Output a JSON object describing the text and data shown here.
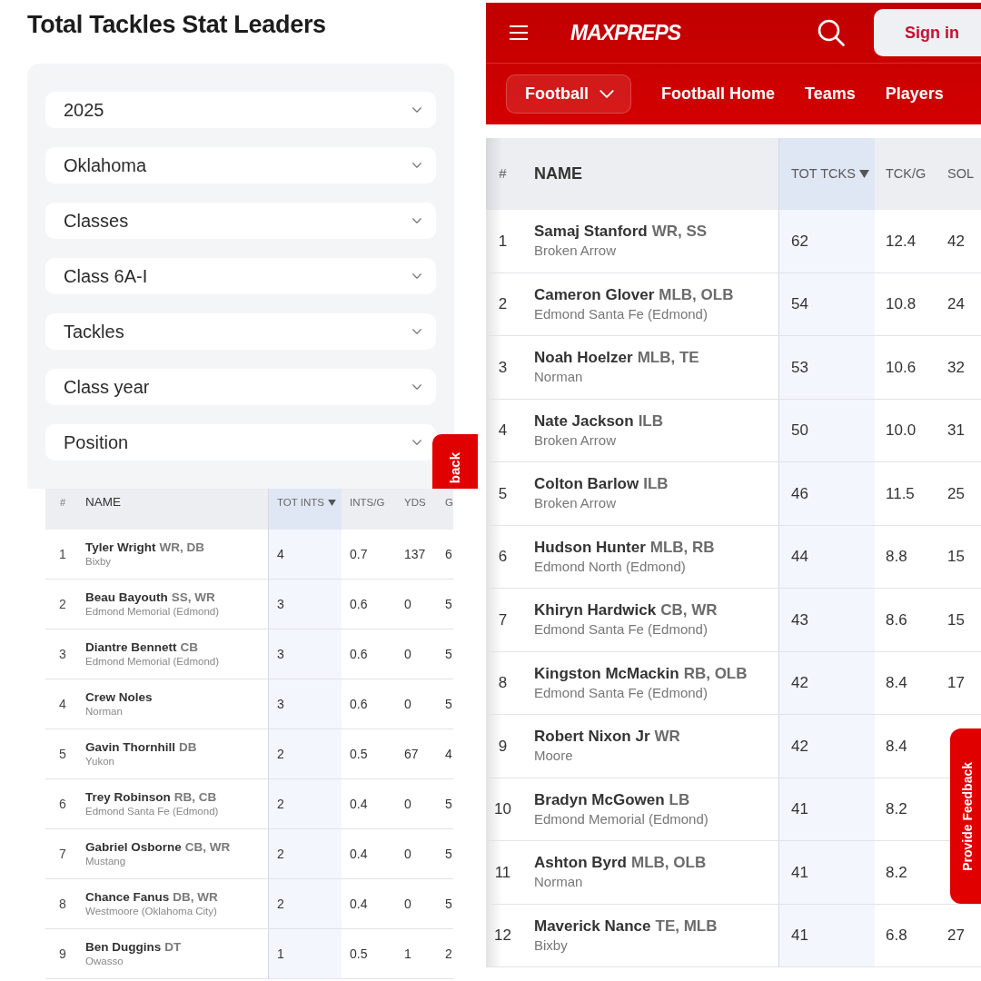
{
  "left_panel": {
    "title": "Total Tackles Stat Leaders",
    "filters": [
      {
        "value": "2025"
      },
      {
        "value": "Oklahoma"
      },
      {
        "value": "Classes"
      },
      {
        "value": "Class 6A-I"
      },
      {
        "value": "Tackles"
      },
      {
        "value": "Class year"
      },
      {
        "value": "Position"
      }
    ],
    "feedback_tab": {
      "label": "back"
    }
  },
  "left_table": {
    "columns": [
      {
        "label": "#",
        "sorted": false
      },
      {
        "label": "NAME",
        "sorted": false
      },
      {
        "label": "TOT INTS",
        "sorted": true
      },
      {
        "label": "INTS/G",
        "sorted": false
      },
      {
        "label": "YDS",
        "sorted": false
      },
      {
        "label": "G",
        "sorted": false
      }
    ],
    "rows": [
      {
        "rank": "1",
        "name": "Tyler Wright",
        "positions": "WR, DB",
        "school": "Bixby",
        "stats": [
          "4",
          "0.7",
          "137",
          "6"
        ]
      },
      {
        "rank": "2",
        "name": "Beau Bayouth",
        "positions": "SS, WR",
        "school": "Edmond Memorial (Edmond)",
        "stats": [
          "3",
          "0.6",
          "0",
          "5"
        ]
      },
      {
        "rank": "3",
        "name": "Diantre Bennett",
        "positions": "CB",
        "school": "Edmond Memorial (Edmond)",
        "stats": [
          "3",
          "0.6",
          "0",
          "5"
        ]
      },
      {
        "rank": "4",
        "name": "Crew Noles",
        "school": "Norman",
        "stats": [
          "3",
          "0.6",
          "0",
          "5"
        ]
      },
      {
        "rank": "5",
        "name": "Gavin Thornhill",
        "positions": "DB",
        "school": "Yukon",
        "stats": [
          "2",
          "0.5",
          "67",
          "4"
        ]
      },
      {
        "rank": "6",
        "name": "Trey Robinson",
        "positions": "RB, CB",
        "school": "Edmond Santa Fe (Edmond)",
        "stats": [
          "2",
          "0.4",
          "0",
          "5"
        ]
      },
      {
        "rank": "7",
        "name": "Gabriel Osborne",
        "positions": "CB, WR",
        "school": "Mustang",
        "stats": [
          "2",
          "0.4",
          "0",
          "5"
        ]
      },
      {
        "rank": "8",
        "name": "Chance Fanus",
        "positions": "DB, WR",
        "school": "Westmoore (Oklahoma City)",
        "stats": [
          "2",
          "0.4",
          "0",
          "5"
        ]
      },
      {
        "rank": "9",
        "name": "Ben Duggins",
        "positions": "DT",
        "school": "Owasso",
        "stats": [
          "1",
          "0.5",
          "1",
          "2"
        ]
      }
    ]
  },
  "right_panel": {
    "logo": "MAXPREPS",
    "sign_in": "Sign in",
    "nav": [
      {
        "label": "Football",
        "kind": "dropdown"
      },
      {
        "label": "Football Home",
        "kind": "link"
      },
      {
        "label": "Teams",
        "kind": "link"
      },
      {
        "label": "Players",
        "kind": "link"
      }
    ],
    "table": {
      "columns": [
        {
          "label": "#",
          "sorted": false
        },
        {
          "label": "NAME",
          "sorted": false
        },
        {
          "label": "TOT TCKS",
          "sorted": true
        },
        {
          "label": "TCK/G",
          "sorted": false
        },
        {
          "label": "SOL",
          "sorted": false
        }
      ],
      "rows": [
        {
          "rank": "1",
          "name": "Samaj Stanford",
          "positions": "WR, SS",
          "school": "Broken Arrow",
          "stats": [
            "62",
            "12.4",
            "42"
          ]
        },
        {
          "rank": "2",
          "name": "Cameron Glover",
          "positions": "MLB, OLB",
          "school": "Edmond Santa Fe (Edmond)",
          "stats": [
            "54",
            "10.8",
            "24"
          ]
        },
        {
          "rank": "3",
          "name": "Noah Hoelzer",
          "positions": "MLB, TE",
          "school": "Norman",
          "stats": [
            "53",
            "10.6",
            "32"
          ]
        },
        {
          "rank": "4",
          "name": "Nate Jackson",
          "positions": "ILB",
          "school": "Broken Arrow",
          "stats": [
            "50",
            "10.0",
            "31"
          ]
        },
        {
          "rank": "5",
          "name": "Colton Barlow",
          "positions": "ILB",
          "school": "Broken Arrow",
          "stats": [
            "46",
            "11.5",
            "25"
          ]
        },
        {
          "rank": "6",
          "name": "Hudson Hunter",
          "positions": "MLB, RB",
          "school": "Edmond North (Edmond)",
          "stats": [
            "44",
            "8.8",
            "15"
          ]
        },
        {
          "rank": "7",
          "name": "Khiryn Hardwick",
          "positions": "CB, WR",
          "school": "Edmond Santa Fe (Edmond)",
          "stats": [
            "43",
            "8.6",
            "15"
          ]
        },
        {
          "rank": "8",
          "name": "Kingston McMackin",
          "positions": "RB, OLB",
          "school": "Edmond Santa Fe (Edmond)",
          "stats": [
            "42",
            "8.4",
            "17"
          ]
        },
        {
          "rank": "9",
          "name": "Robert Nixon Jr",
          "positions": "WR",
          "school": "Moore",
          "stats": [
            "42",
            "8.4"
          ]
        },
        {
          "rank": "10",
          "name": "Bradyn McGowen",
          "positions": "LB",
          "school": "Edmond Memorial (Edmond)",
          "stats": [
            "41",
            "8.2"
          ]
        },
        {
          "rank": "11",
          "name": "Ashton Byrd",
          "positions": "MLB, OLB",
          "school": "Norman",
          "stats": [
            "41",
            "8.2"
          ]
        },
        {
          "rank": "12",
          "name": "Maverick Nance",
          "positions": "TE, MLB",
          "school": "Bixby",
          "stats": [
            "41",
            "6.8",
            "27"
          ]
        }
      ]
    },
    "feedback_tab": {
      "label": "Provide Feedback"
    }
  }
}
